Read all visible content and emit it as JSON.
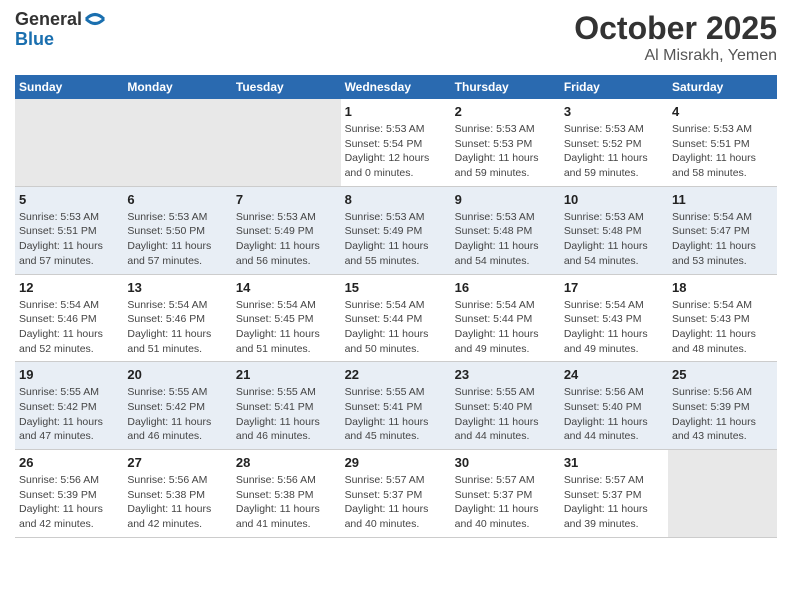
{
  "header": {
    "logo_general": "General",
    "logo_blue": "Blue",
    "month": "October 2025",
    "location": "Al Misrakh, Yemen"
  },
  "weekdays": [
    "Sunday",
    "Monday",
    "Tuesday",
    "Wednesday",
    "Thursday",
    "Friday",
    "Saturday"
  ],
  "weeks": [
    [
      {
        "day": "",
        "info": ""
      },
      {
        "day": "",
        "info": ""
      },
      {
        "day": "",
        "info": ""
      },
      {
        "day": "1",
        "info": "Sunrise: 5:53 AM\nSunset: 5:54 PM\nDaylight: 12 hours\nand 0 minutes."
      },
      {
        "day": "2",
        "info": "Sunrise: 5:53 AM\nSunset: 5:53 PM\nDaylight: 11 hours\nand 59 minutes."
      },
      {
        "day": "3",
        "info": "Sunrise: 5:53 AM\nSunset: 5:52 PM\nDaylight: 11 hours\nand 59 minutes."
      },
      {
        "day": "4",
        "info": "Sunrise: 5:53 AM\nSunset: 5:51 PM\nDaylight: 11 hours\nand 58 minutes."
      }
    ],
    [
      {
        "day": "5",
        "info": "Sunrise: 5:53 AM\nSunset: 5:51 PM\nDaylight: 11 hours\nand 57 minutes."
      },
      {
        "day": "6",
        "info": "Sunrise: 5:53 AM\nSunset: 5:50 PM\nDaylight: 11 hours\nand 57 minutes."
      },
      {
        "day": "7",
        "info": "Sunrise: 5:53 AM\nSunset: 5:49 PM\nDaylight: 11 hours\nand 56 minutes."
      },
      {
        "day": "8",
        "info": "Sunrise: 5:53 AM\nSunset: 5:49 PM\nDaylight: 11 hours\nand 55 minutes."
      },
      {
        "day": "9",
        "info": "Sunrise: 5:53 AM\nSunset: 5:48 PM\nDaylight: 11 hours\nand 54 minutes."
      },
      {
        "day": "10",
        "info": "Sunrise: 5:53 AM\nSunset: 5:48 PM\nDaylight: 11 hours\nand 54 minutes."
      },
      {
        "day": "11",
        "info": "Sunrise: 5:54 AM\nSunset: 5:47 PM\nDaylight: 11 hours\nand 53 minutes."
      }
    ],
    [
      {
        "day": "12",
        "info": "Sunrise: 5:54 AM\nSunset: 5:46 PM\nDaylight: 11 hours\nand 52 minutes."
      },
      {
        "day": "13",
        "info": "Sunrise: 5:54 AM\nSunset: 5:46 PM\nDaylight: 11 hours\nand 51 minutes."
      },
      {
        "day": "14",
        "info": "Sunrise: 5:54 AM\nSunset: 5:45 PM\nDaylight: 11 hours\nand 51 minutes."
      },
      {
        "day": "15",
        "info": "Sunrise: 5:54 AM\nSunset: 5:44 PM\nDaylight: 11 hours\nand 50 minutes."
      },
      {
        "day": "16",
        "info": "Sunrise: 5:54 AM\nSunset: 5:44 PM\nDaylight: 11 hours\nand 49 minutes."
      },
      {
        "day": "17",
        "info": "Sunrise: 5:54 AM\nSunset: 5:43 PM\nDaylight: 11 hours\nand 49 minutes."
      },
      {
        "day": "18",
        "info": "Sunrise: 5:54 AM\nSunset: 5:43 PM\nDaylight: 11 hours\nand 48 minutes."
      }
    ],
    [
      {
        "day": "19",
        "info": "Sunrise: 5:55 AM\nSunset: 5:42 PM\nDaylight: 11 hours\nand 47 minutes."
      },
      {
        "day": "20",
        "info": "Sunrise: 5:55 AM\nSunset: 5:42 PM\nDaylight: 11 hours\nand 46 minutes."
      },
      {
        "day": "21",
        "info": "Sunrise: 5:55 AM\nSunset: 5:41 PM\nDaylight: 11 hours\nand 46 minutes."
      },
      {
        "day": "22",
        "info": "Sunrise: 5:55 AM\nSunset: 5:41 PM\nDaylight: 11 hours\nand 45 minutes."
      },
      {
        "day": "23",
        "info": "Sunrise: 5:55 AM\nSunset: 5:40 PM\nDaylight: 11 hours\nand 44 minutes."
      },
      {
        "day": "24",
        "info": "Sunrise: 5:56 AM\nSunset: 5:40 PM\nDaylight: 11 hours\nand 44 minutes."
      },
      {
        "day": "25",
        "info": "Sunrise: 5:56 AM\nSunset: 5:39 PM\nDaylight: 11 hours\nand 43 minutes."
      }
    ],
    [
      {
        "day": "26",
        "info": "Sunrise: 5:56 AM\nSunset: 5:39 PM\nDaylight: 11 hours\nand 42 minutes."
      },
      {
        "day": "27",
        "info": "Sunrise: 5:56 AM\nSunset: 5:38 PM\nDaylight: 11 hours\nand 42 minutes."
      },
      {
        "day": "28",
        "info": "Sunrise: 5:56 AM\nSunset: 5:38 PM\nDaylight: 11 hours\nand 41 minutes."
      },
      {
        "day": "29",
        "info": "Sunrise: 5:57 AM\nSunset: 5:37 PM\nDaylight: 11 hours\nand 40 minutes."
      },
      {
        "day": "30",
        "info": "Sunrise: 5:57 AM\nSunset: 5:37 PM\nDaylight: 11 hours\nand 40 minutes."
      },
      {
        "day": "31",
        "info": "Sunrise: 5:57 AM\nSunset: 5:37 PM\nDaylight: 11 hours\nand 39 minutes."
      },
      {
        "day": "",
        "info": ""
      }
    ]
  ]
}
